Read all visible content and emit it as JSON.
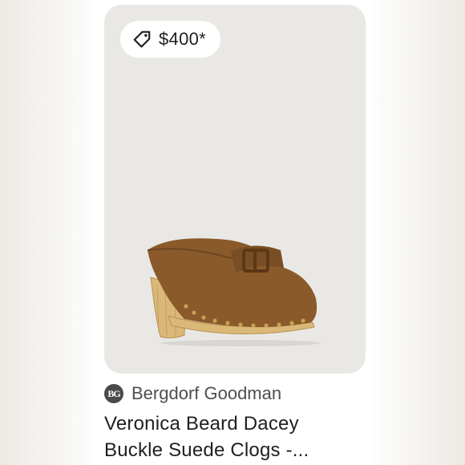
{
  "listing": {
    "price": "$400*",
    "seller": "Bergdorf Goodman",
    "seller_logo_text": "BG",
    "title_line1": "Veronica Beard Dacey",
    "title_line2": "Buckle Suede Clogs -...",
    "icons": {
      "price": "price-tag-icon",
      "seller": "seller-logo"
    },
    "colors": {
      "image_background": "#e9e8e5",
      "suede": "#8a5a2b",
      "wood_heel": "#d9b878",
      "studs": "#c9a050"
    }
  }
}
